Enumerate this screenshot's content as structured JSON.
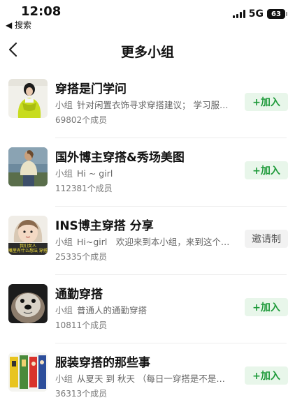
{
  "status_bar": {
    "time": "12:08",
    "back_app_label": "◀ 搜索",
    "network": "5G",
    "battery": "63"
  },
  "nav": {
    "back_icon": "chevron-left-icon",
    "title": "更多小组"
  },
  "groups": [
    {
      "name": "穿搭是门学问",
      "tag": "小组",
      "description": "针对闲置衣饰寻求穿搭建议； 学习服…",
      "members": "69802个成员",
      "action": "+加入"
    },
    {
      "name": "国外博主穿搭&秀场美图",
      "tag": "小组",
      "description": "Hi ~ girl",
      "members": "112381个成员",
      "action": "+加入"
    },
    {
      "name": "INS博主穿搭 分享",
      "tag": "小组",
      "description": "Hi~girl　欢迎来到本小组，来到这个…",
      "members": "25335个成员",
      "action": "邀请制",
      "thumb_text_1": "我们女人",
      "thumb_text_2": "嘴里有什么想法 穿搭就"
    },
    {
      "name": "通勤穿搭",
      "tag": "小组",
      "description": "普通人的通勤穿搭",
      "members": "10811个成员",
      "action": "+加入"
    },
    {
      "name": "服装穿搭的那些事",
      "tag": "小组",
      "description": "从夏天 到 秋天 （每日一穿搭是不是…",
      "members": "36313个成员",
      "action": "+加入"
    }
  ],
  "colors": {
    "join_text": "#1e9a3a",
    "join_bg": "#e8f6ea",
    "invite_bg": "#f2f2f2"
  }
}
